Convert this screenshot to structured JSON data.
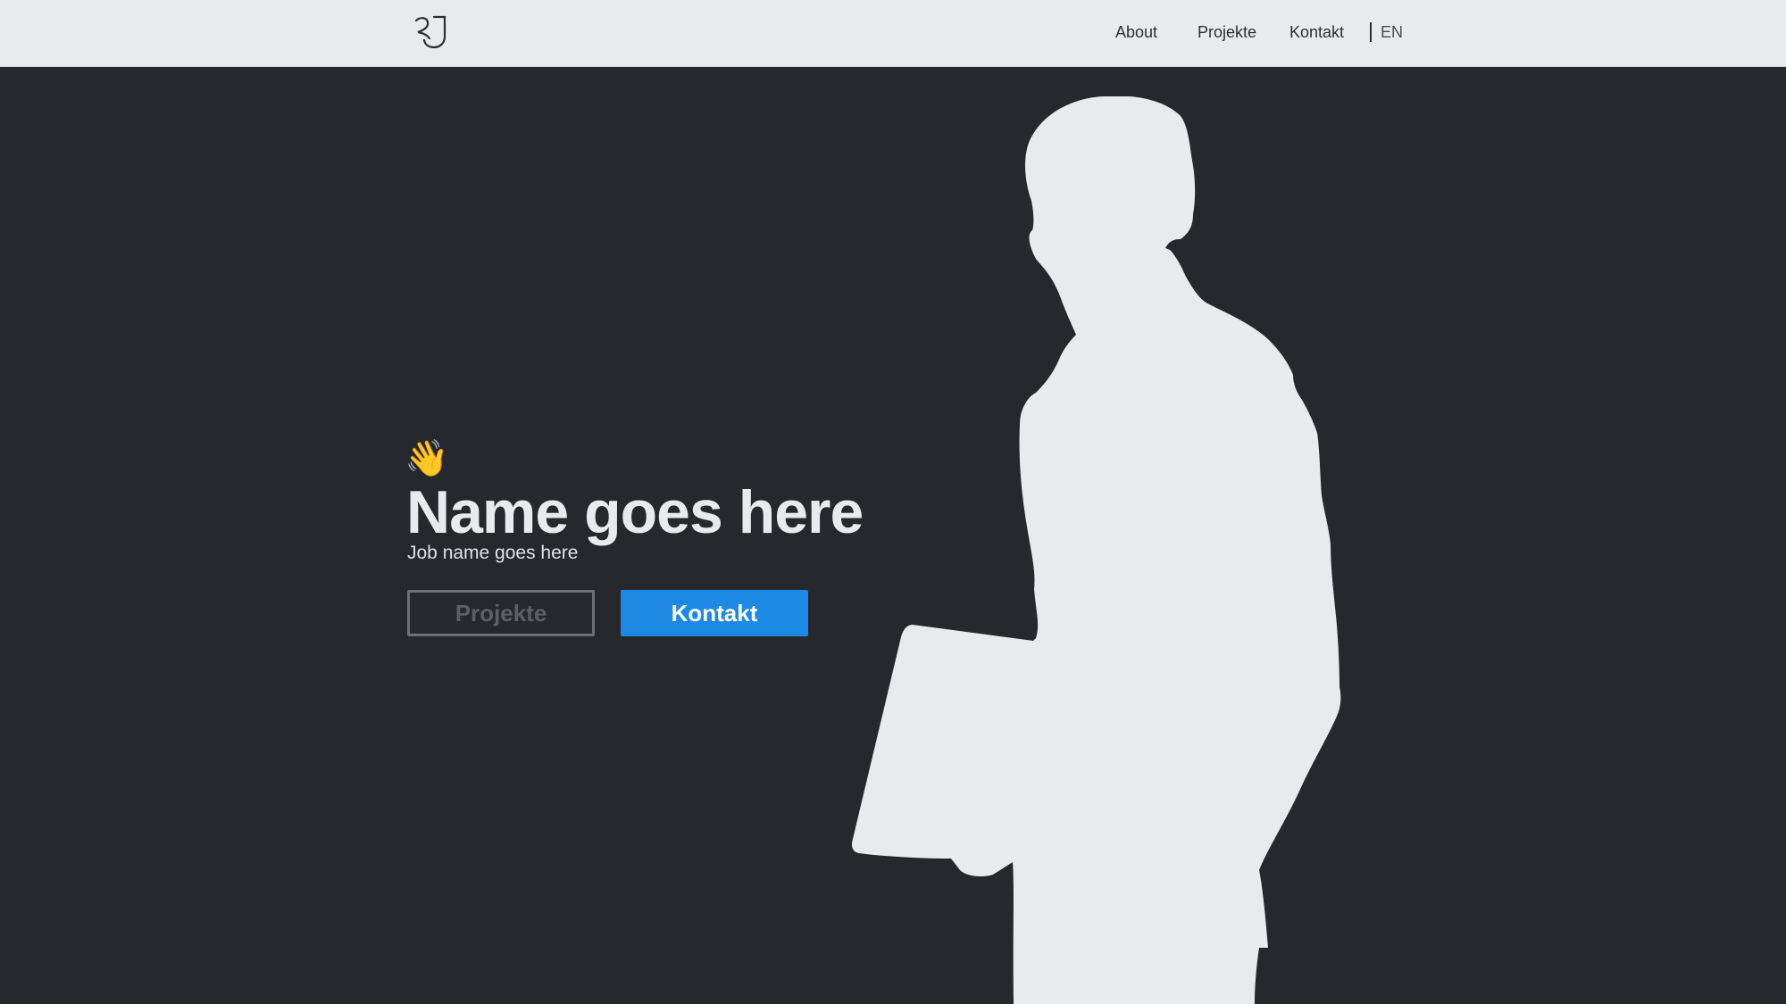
{
  "header": {
    "logo": {
      "icon": "logo-monogram-icon"
    },
    "nav": {
      "items": [
        {
          "label": "About"
        },
        {
          "label": "Projekte"
        },
        {
          "label": "Kontakt"
        }
      ],
      "language": "EN"
    }
  },
  "hero": {
    "wave_emoji": "👋",
    "name": "Name goes here",
    "job": "Job name goes here",
    "buttons": {
      "projects_label": "Projekte",
      "contact_label": "Kontakt"
    },
    "image": {
      "icon": "person-silhouette-with-laptop"
    }
  },
  "colors": {
    "header_bg": "#e8eaed",
    "hero_bg": "#25292d",
    "primary": "#1e88e5",
    "silhouette": "#e8eaed"
  }
}
